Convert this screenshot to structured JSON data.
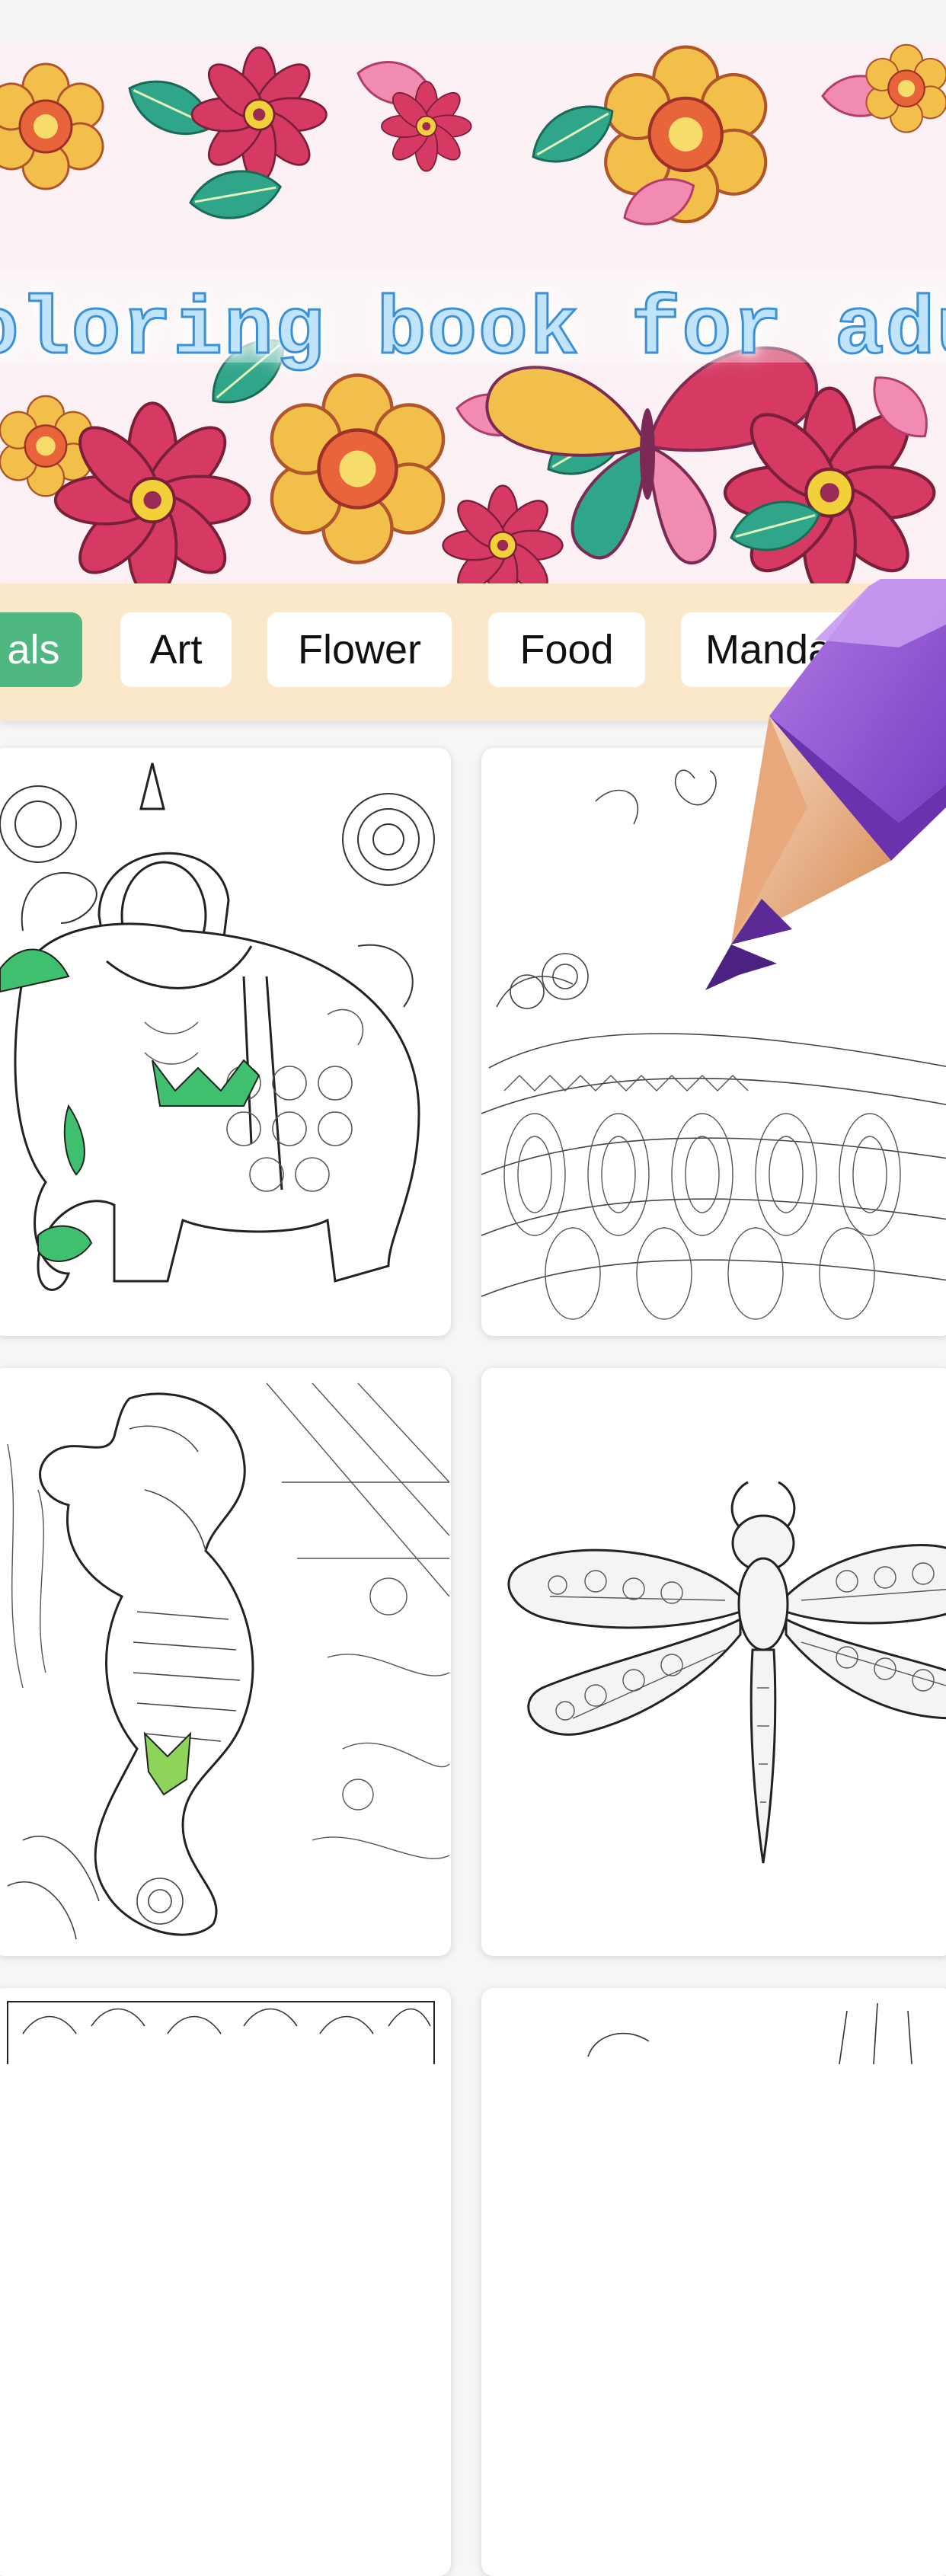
{
  "banner": {
    "title": "oloring book for adults"
  },
  "categories": [
    {
      "label": "als",
      "active": true
    },
    {
      "label": "Art",
      "active": false
    },
    {
      "label": "Flower",
      "active": false
    },
    {
      "label": "Food",
      "active": false
    },
    {
      "label": "Mandala",
      "active": false
    }
  ],
  "grid": {
    "items": [
      {
        "subject": "elephant",
        "partially_colored": true
      },
      {
        "subject": "peacock",
        "partially_colored": false
      },
      {
        "subject": "seahorse",
        "partially_colored": true
      },
      {
        "subject": "dragonfly",
        "partially_colored": false
      },
      {
        "subject": "leaf pattern",
        "partially_colored": false
      },
      {
        "subject": "bird",
        "partially_colored": false
      }
    ]
  },
  "colors": {
    "active_chip": "#4fb882",
    "category_bar": "#fbe8c8",
    "coloring_green": "#3fc06e",
    "pencil_purple": "#9b55d6",
    "title_blue": "#3d8fd6"
  },
  "icons": [
    "pencil-icon"
  ]
}
